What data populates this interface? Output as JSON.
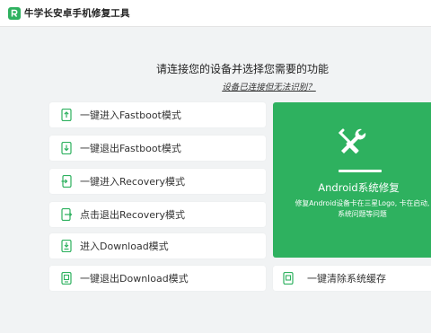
{
  "app": {
    "title": "牛学长安卓手机修复工具",
    "logo_icon": "logo-r-icon"
  },
  "main": {
    "heading": "请连接您的设备并选择您需要的功能",
    "link": "设备已连接但无法识别？"
  },
  "buttons": [
    {
      "label": "一键进入Fastboot模式",
      "icon": "phone-arrow-up-icon"
    },
    {
      "label": "一键退出Fastboot模式",
      "icon": "phone-arrow-down-icon"
    },
    {
      "label": "一键进入Recovery模式",
      "icon": "phone-arrow-in-icon"
    },
    {
      "label": "点击退出Recovery模式",
      "icon": "phone-arrow-out-icon"
    },
    {
      "label": "进入Download模式",
      "icon": "phone-download-icon"
    },
    {
      "label": "一键退出Download模式",
      "icon": "phone-exit-icon"
    }
  ],
  "repair": {
    "title": "Android系统修复",
    "desc_line1": "修复Android设备卡在三星Logo, 卡在启动,",
    "desc_line2": "系统问题等问题",
    "icon": "wrench-screwdriver-icon"
  },
  "cache": {
    "label": "一键清除系统缓存",
    "icon": "phone-clean-icon"
  },
  "colors": {
    "accent": "#2eb15f",
    "background": "#f1f3f4",
    "card": "#ffffff"
  }
}
